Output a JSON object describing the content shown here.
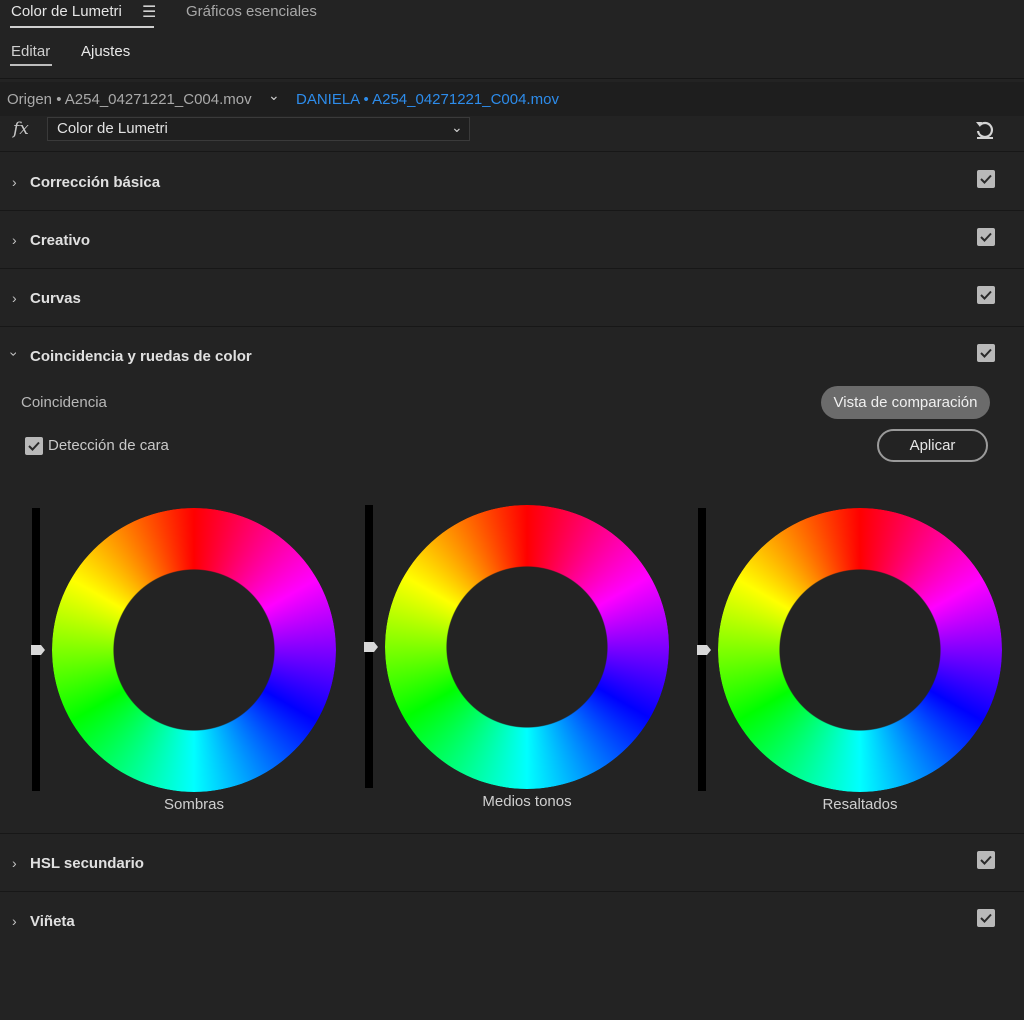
{
  "tabs": {
    "active_label": "Color de Lumetri",
    "second_label": "Gráficos esenciales",
    "menu_icon": "hamburger-menu-icon"
  },
  "subtabs": {
    "edit": "Editar",
    "settings": "Ajustes"
  },
  "source": {
    "origin_text": "Origen • A254_04271221_C004.mov",
    "sequence_link": "DANIELA • A254_04271221_C004.mov"
  },
  "effect": {
    "fx_label": "fx",
    "select_value": "Color de Lumetri",
    "reset_icon": "reset-icon"
  },
  "sections": {
    "basic": "Corrección básica",
    "creative": "Creativo",
    "curves": "Curvas",
    "color_match": "Coincidencia y ruedas de color",
    "hsl": "HSL secundario",
    "vignette": "Viñeta"
  },
  "color_match": {
    "coincidencia_label": "Coincidencia",
    "compare_button": "Vista de comparación",
    "face_detection_label": "Detección de cara",
    "face_detection_checked": true,
    "apply_button": "Aplicar"
  },
  "wheels": {
    "shadows": "Sombras",
    "midtones": "Medios tonos",
    "highlights": "Resaltados"
  },
  "colors": {
    "background": "#232323",
    "link_blue": "#2d8ceb",
    "checkbox_fill": "#b9b9b9"
  }
}
